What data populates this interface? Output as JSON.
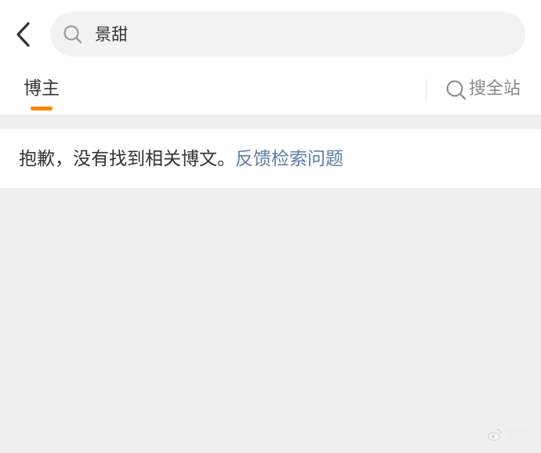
{
  "header": {
    "back_icon": "chevron-left-icon",
    "search": {
      "icon": "search-icon",
      "query": "景甜"
    }
  },
  "tabs": {
    "active": {
      "label": "博主",
      "underline_color": "#ff8200"
    },
    "site_search": {
      "icon": "search-icon",
      "label": "搜全站"
    }
  },
  "result": {
    "message": "抱歉，没有找到相关博文。",
    "feedback_link": "反馈检索问题",
    "link_color": "#5a7ea6"
  },
  "watermark": {
    "text": "微博"
  }
}
